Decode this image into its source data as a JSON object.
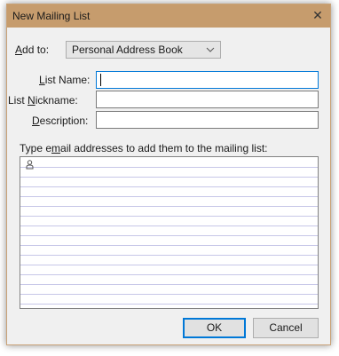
{
  "window": {
    "title": "New Mailing List",
    "close_glyph": "✕"
  },
  "add_to": {
    "label_pre": "",
    "label_accel": "A",
    "label_post": "dd to:",
    "selected": "Personal Address Book"
  },
  "fields": {
    "list_name": {
      "label_accel": "L",
      "label_post": "ist Name:",
      "value": ""
    },
    "list_nickname": {
      "label_pre": "List ",
      "label_accel": "N",
      "label_post": "ickname:",
      "value": ""
    },
    "description": {
      "label_accel": "D",
      "label_post": "escription:",
      "value": ""
    }
  },
  "email_prompt": {
    "pre": "Type e",
    "accel": "m",
    "post": "ail addresses to add them to the mailing list:"
  },
  "email_list": {
    "row_count": 15,
    "first_row_icon": "person-icon"
  },
  "buttons": {
    "ok": "OK",
    "cancel": "Cancel"
  },
  "colors": {
    "titlebar": "#c69c6d",
    "focus_border": "#0078d7",
    "row_line": "#c7c7e8"
  }
}
